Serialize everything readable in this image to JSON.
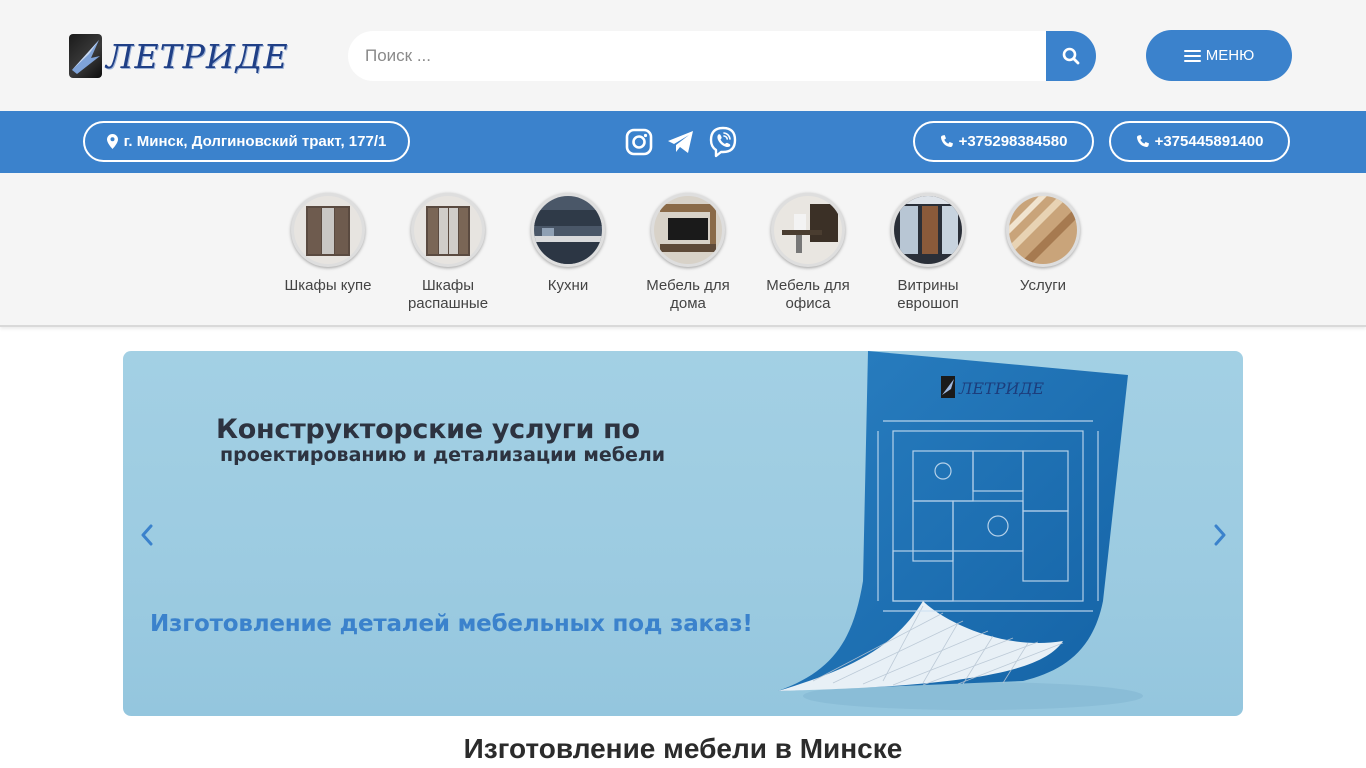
{
  "header": {
    "logo_text": "ЛЕТРИДЕ",
    "search_placeholder": "Поиск ...",
    "menu_label": "МЕНЮ"
  },
  "contact_bar": {
    "address": "г. Минск, Долгиновский тракт, 177/1",
    "socials": [
      "instagram-icon",
      "telegram-icon",
      "viber-icon"
    ],
    "phones": [
      "+375298384580",
      "+375445891400"
    ]
  },
  "categories": [
    {
      "label": "Шкафы купе",
      "icon": "wardrobe-coupe"
    },
    {
      "label": "Шкафы распашные",
      "icon": "wardrobe-swing"
    },
    {
      "label": "Кухни",
      "icon": "kitchen"
    },
    {
      "label": "Мебель для дома",
      "icon": "home-furniture"
    },
    {
      "label": "Мебель для офиса",
      "icon": "office-furniture"
    },
    {
      "label": "Витрины еврошоп",
      "icon": "showcase"
    },
    {
      "label": "Услуги",
      "icon": "services"
    }
  ],
  "slider": {
    "heading": "Конструкторские услуги по",
    "subheading": "проектированию и детализации мебели",
    "tagline": "Изготовление деталей мебельных под заказ!",
    "sheet_logo": "ЛЕТРИДЕ"
  },
  "section_title": "Изготовление мебели в Минске",
  "colors": {
    "accent": "#3b82cc",
    "header_bg": "#f5f5f5",
    "slider_bg": "#9ccbe1"
  }
}
